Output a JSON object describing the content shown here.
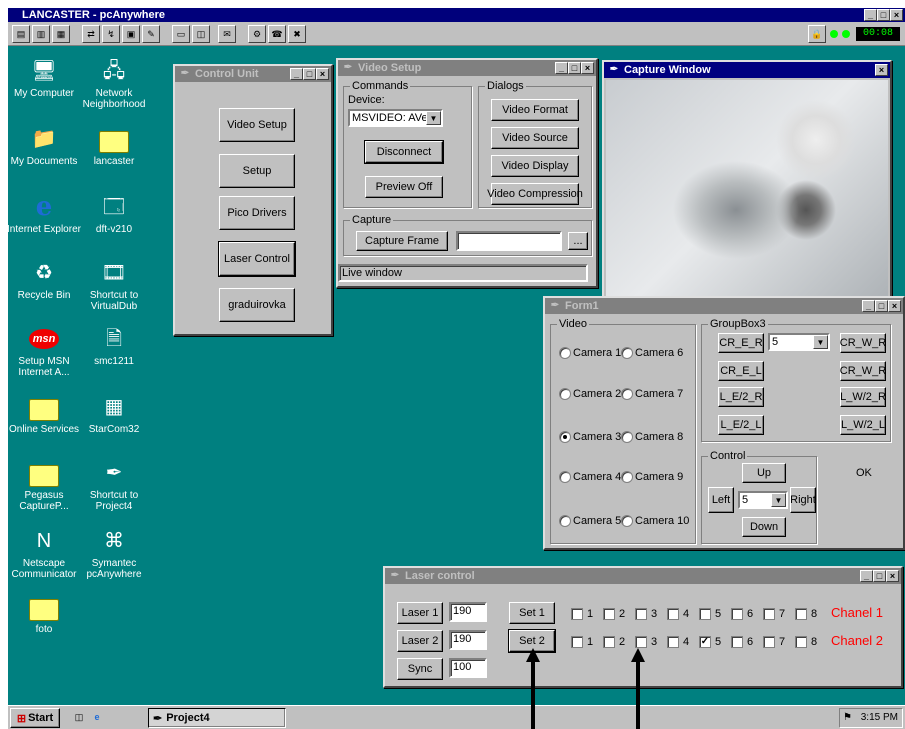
{
  "remote_title": "LANCASTER - pcAnywhere",
  "remote_timer": "00:08",
  "desktop_icons": [
    {
      "label": "My Computer"
    },
    {
      "label": "Network Neighborhood"
    },
    {
      "label": "My Documents"
    },
    {
      "label": "lancaster"
    },
    {
      "label": "Internet Explorer"
    },
    {
      "label": "dft-v210"
    },
    {
      "label": "Recycle Bin"
    },
    {
      "label": "Shortcut to VirtualDub"
    },
    {
      "label": "Setup MSN Internet A..."
    },
    {
      "label": "smc1211"
    },
    {
      "label": "Online Services"
    },
    {
      "label": "StarCom32"
    },
    {
      "label": "Pegasus CaptureP..."
    },
    {
      "label": "Shortcut to Project4"
    },
    {
      "label": "Netscape Communicator"
    },
    {
      "label": "Symantec pcAnywhere"
    },
    {
      "label": "foto"
    }
  ],
  "control_unit": {
    "title": "Control Unit",
    "buttons": [
      "Video Setup",
      "Setup",
      "Pico Drivers",
      "Laser Control",
      "graduirovka"
    ]
  },
  "video_setup": {
    "title": "Video Setup",
    "commands_label": "Commands",
    "device_label": "Device:",
    "device_value": "MSVIDEO: AVerM",
    "disconnect": "Disconnect",
    "preview_off": "Preview Off",
    "dialogs_label": "Dialogs",
    "video_format": "Video Format",
    "video_source": "Video Source",
    "video_display": "Video Display",
    "video_compression": "Video Compression",
    "capture_label": "Capture",
    "capture_frame": "Capture Frame",
    "capture_value": "",
    "browse": "...",
    "status": "Live window"
  },
  "capture_window": {
    "title": "Capture Window"
  },
  "form1": {
    "title": "Form1",
    "video_label": "Video",
    "cameras_left": [
      "Camera 1",
      "Camera 2",
      "Camera 3",
      "Camera 4",
      "Camera 5"
    ],
    "cameras_right": [
      "Camera 6",
      "Camera 7",
      "Camera 8",
      "Camera 9",
      "Camera 10"
    ],
    "selected_camera": "Camera 3",
    "groupbox3_label": "GroupBox3",
    "cr_e_r": "CR_E_R",
    "combo_value": "5",
    "cr_w_r1": "CR_W_R",
    "cr_e_l": "CR_E_L",
    "cr_w_r2": "CR_W_R",
    "l_e2_r": "L_E/2_R",
    "l_w2_r": "L_W/2_R",
    "l_e2_l": "L_E/2_L",
    "l_w2_l": "L_W/2_L",
    "control_label": "Control",
    "up": "Up",
    "left": "Left",
    "step_value": "5",
    "right": "Right",
    "down": "Down",
    "ok": "OK"
  },
  "laser_control": {
    "title": "Laser control",
    "laser1": "Laser 1",
    "laser1_value": "190",
    "laser2": "Laser 2",
    "laser2_value": "190",
    "sync": "Sync",
    "sync_value": "100",
    "set1": "Set 1",
    "set2": "Set 2",
    "row1_checks": [
      "1",
      "2",
      "3",
      "4",
      "5",
      "6",
      "7",
      "8"
    ],
    "row1_checked": [],
    "row2_checks": [
      "1",
      "2",
      "3",
      "4",
      "5",
      "6",
      "7",
      "8"
    ],
    "row2_checked": [
      "5"
    ],
    "chanel1": "Chanel 1",
    "chanel2": "Chanel 2",
    "chanel_color": "#ff0000"
  },
  "taskbar": {
    "start": "Start",
    "task": "Project4",
    "clock": "3:15 PM"
  }
}
